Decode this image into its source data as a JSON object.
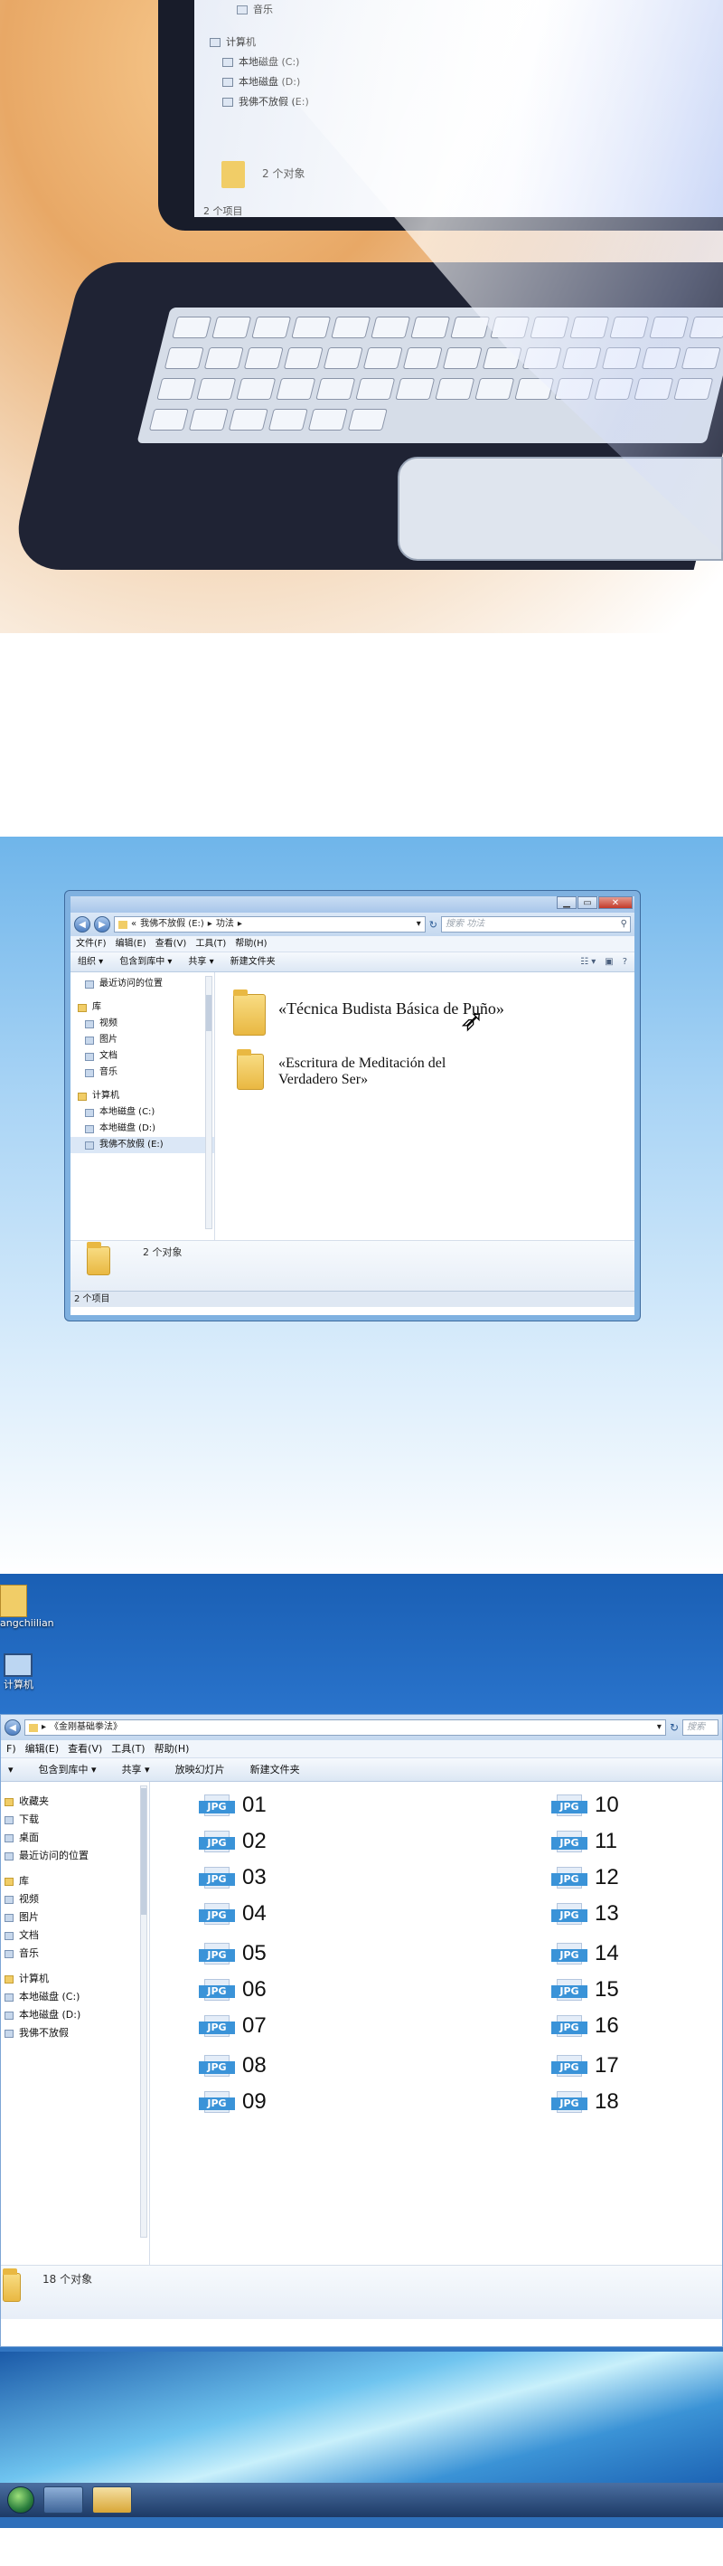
{
  "panel1": {
    "nav_items": [
      "音乐",
      "计算机",
      "本地磁盘 (C:)",
      "本地磁盘 (D:)",
      "我佛不放假 (E:)"
    ],
    "object_count": "2 个对象",
    "status": "2 个项目"
  },
  "panel2": {
    "title_controls": [
      "▁",
      "▭",
      "✕"
    ],
    "nav_back": "◀",
    "nav_forward": "▶",
    "address": [
      "«",
      "我佛不放假 (E:)",
      "▸",
      "功法",
      "▸"
    ],
    "address_dropdown": "▾",
    "address_refresh": "↻",
    "search_placeholder": "搜索 功法",
    "search_icon": "⚲",
    "menu": [
      "文件(F)",
      "编辑(E)",
      "查看(V)",
      "工具(T)",
      "帮助(H)"
    ],
    "toolbar": [
      "组织 ▾",
      "包含到库中 ▾",
      "共享 ▾",
      "新建文件夹"
    ],
    "toolbar_icons": [
      "☷ ▾",
      "▣",
      "?"
    ],
    "sidebar": [
      {
        "label": "最近访问的位置",
        "group": false
      },
      {
        "label": "库",
        "group": true
      },
      {
        "label": "视频",
        "group": false
      },
      {
        "label": "图片",
        "group": false
      },
      {
        "label": "文档",
        "group": false
      },
      {
        "label": "音乐",
        "group": false
      },
      {
        "label": "计算机",
        "group": true
      },
      {
        "label": "本地磁盘 (C:)",
        "group": false
      },
      {
        "label": "本地磁盘 (D:)",
        "group": false
      },
      {
        "label": "我佛不放假 (E:)",
        "group": false
      }
    ],
    "folders": [
      {
        "name": "«Técnica Budista Básica de Puño»"
      },
      {
        "name_line1": "«Escritura de Meditación del",
        "name_line2": "Verdadero Ser»"
      }
    ],
    "object_count": "2 个对象",
    "status": "2 个项目"
  },
  "panel3": {
    "desktop_icons": [
      "angchiilian",
      "计算机"
    ],
    "nav_back": "◀",
    "address": [
      "▸",
      "《金刚基础拳法》"
    ],
    "address_dropdown": "▾",
    "address_refresh": "↻",
    "search_placeholder": "搜索",
    "menu": [
      "F)",
      "编辑(E)",
      "查看(V)",
      "工具(T)",
      "帮助(H)"
    ],
    "toolbar": [
      "▾",
      "包含到库中 ▾",
      "共享 ▾",
      "放映幻灯片",
      "新建文件夹"
    ],
    "sidebar": [
      {
        "label": "收藏夹",
        "group": true
      },
      {
        "label": "下载",
        "group": false
      },
      {
        "label": "桌面",
        "group": false
      },
      {
        "label": "最近访问的位置",
        "group": false
      },
      {
        "label": "库",
        "group": true
      },
      {
        "label": "视频",
        "group": false
      },
      {
        "label": "图片",
        "group": false
      },
      {
        "label": "文档",
        "group": false
      },
      {
        "label": "音乐",
        "group": false
      },
      {
        "label": "计算机",
        "group": true
      },
      {
        "label": "本地磁盘 (C:)",
        "group": false
      },
      {
        "label": "本地磁盘 (D:)",
        "group": false
      },
      {
        "label": "我佛不放假",
        "group": false
      }
    ],
    "file_tag": "JPG",
    "files": [
      "01",
      "02",
      "03",
      "04",
      "05",
      "06",
      "07",
      "08",
      "09",
      "10",
      "11",
      "12",
      "13",
      "14",
      "15",
      "16",
      "17",
      "18"
    ],
    "object_count": "18 个对象"
  },
  "colors": {
    "accent": "#3a93d8",
    "folder": "#f1cd67",
    "sky_top": "#6fb5ea",
    "desktop": "#2a74cc"
  }
}
